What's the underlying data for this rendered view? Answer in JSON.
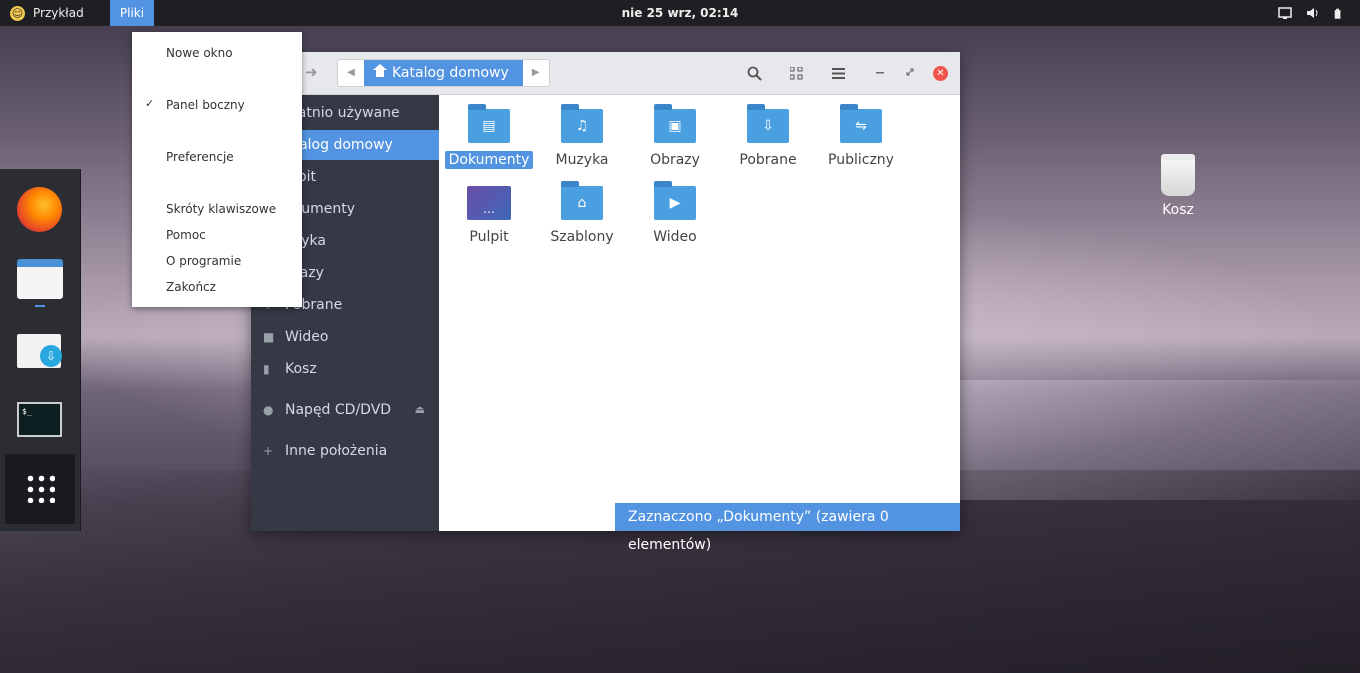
{
  "topbar": {
    "app_name": "Przykład",
    "menu_label": "Pliki",
    "clock": "nie 25 wrz, 02:14"
  },
  "dropdown": {
    "items": [
      "Nowe okno",
      "Panel boczny",
      "Preferencje",
      "Skróty klawiszowe",
      "Pomoc",
      "O programie",
      "Zakończ"
    ],
    "checked_item": "Panel boczny",
    "check_mark": "✓"
  },
  "window": {
    "path_label": "Katalog domowy",
    "sidebar": [
      {
        "label": "statnio używane",
        "icon": "clock-icon"
      },
      {
        "label": "atalog domowy",
        "icon": "home-icon",
        "active": true
      },
      {
        "label": "ulpit",
        "icon": "desktop-icon"
      },
      {
        "label": "okumenty",
        "icon": "document-icon"
      },
      {
        "label": "uzyka",
        "icon": "music-icon"
      },
      {
        "label": "brazy",
        "icon": "image-icon"
      },
      {
        "label": "Pobrane",
        "icon": "download-icon"
      },
      {
        "label": "Wideo",
        "icon": "video-icon"
      },
      {
        "label": "Kosz",
        "icon": "trash-icon"
      },
      {
        "label": "Napęd CD/DVD",
        "icon": "disc-icon"
      },
      {
        "label": "Inne położenia",
        "icon": "plus-icon"
      }
    ],
    "files": [
      {
        "label": "Dokumenty",
        "glyph": "▤",
        "selected": true
      },
      {
        "label": "Muzyka",
        "glyph": "♫"
      },
      {
        "label": "Obrazy",
        "glyph": "▣"
      },
      {
        "label": "Pobrane",
        "glyph": "⇩"
      },
      {
        "label": "Publiczny",
        "glyph": "⇋"
      },
      {
        "label": "Pulpit",
        "glyph": "..."
      },
      {
        "label": "Szablony",
        "glyph": "⌂"
      },
      {
        "label": "Wideo",
        "glyph": "▶"
      }
    ],
    "status": "Zaznaczono „Dokumenty”  (zawiera 0 elementów)"
  },
  "desktop": {
    "trash_label": "Kosz"
  },
  "colors": {
    "accent": "#5294e2",
    "sidebar_bg": "#353945",
    "topbar_bg": "#1e1f22"
  }
}
